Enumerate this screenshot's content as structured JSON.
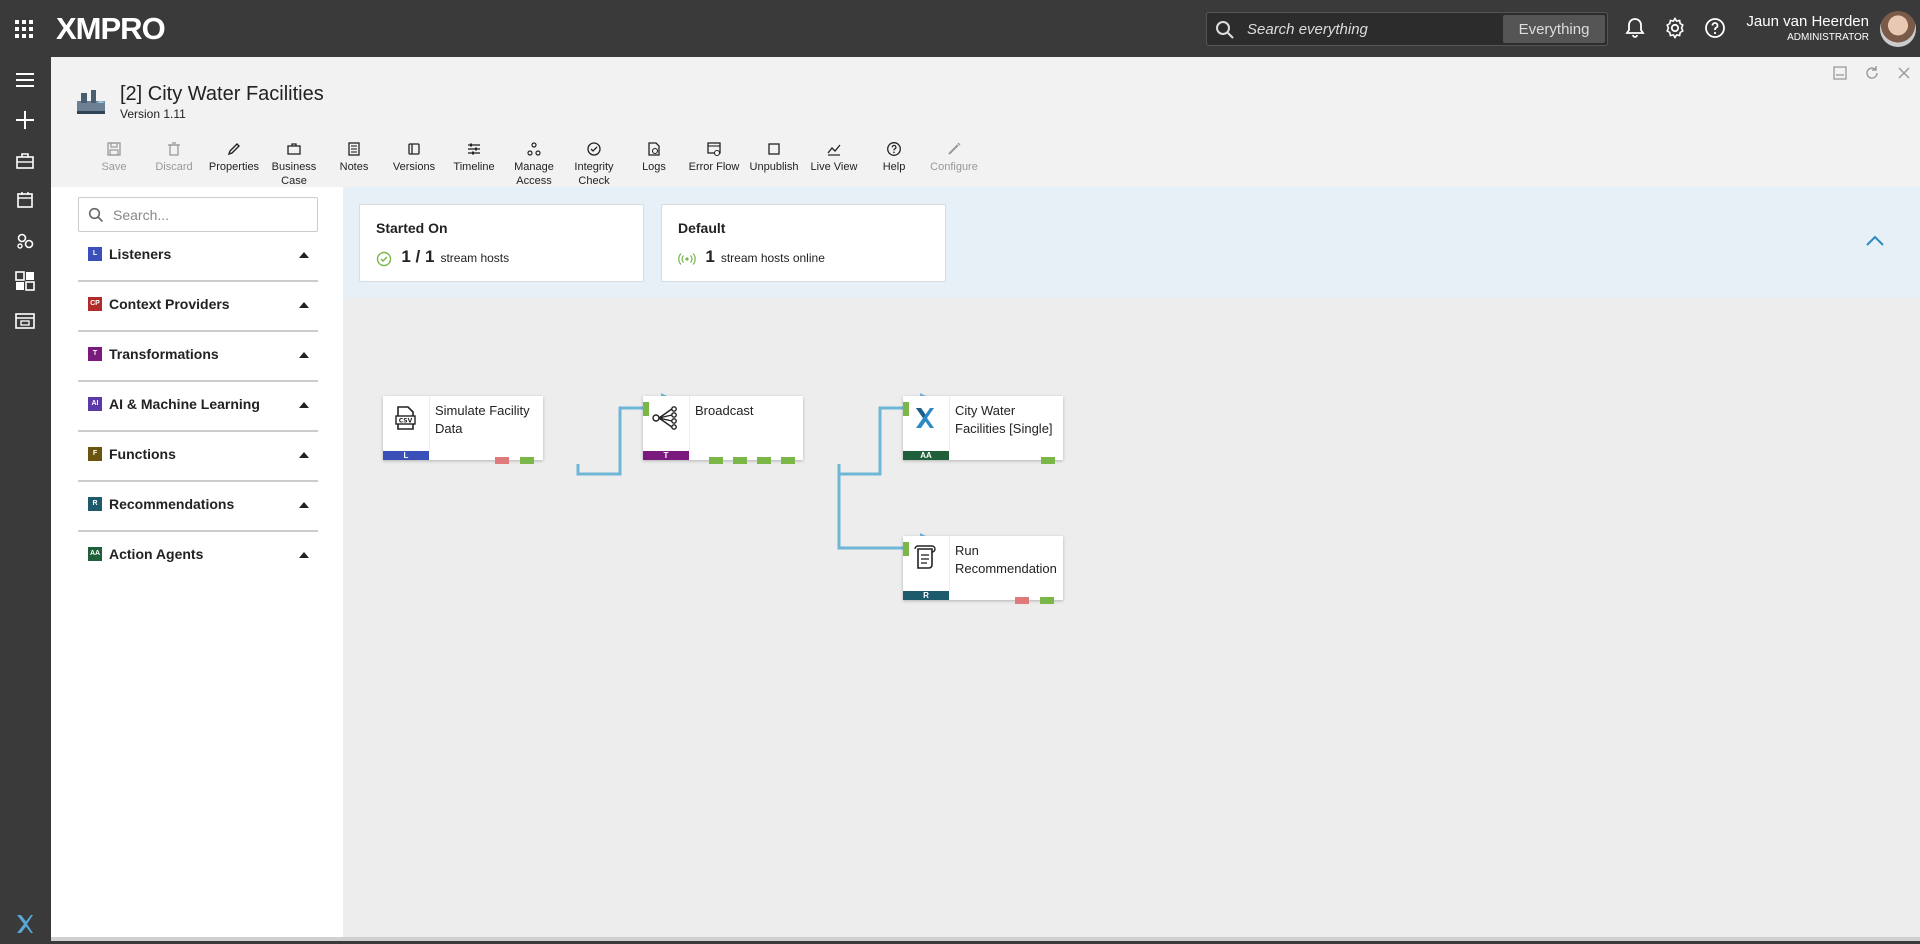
{
  "topbar": {
    "logo": "XMPRO",
    "search_placeholder": "Search everything",
    "search_scope": "Everything",
    "user_name": "Jaun van Heerden",
    "user_role": "ADMINISTRATOR"
  },
  "datastream": {
    "title": "[2] City Water Facilities",
    "version": "Version 1.11"
  },
  "toolbar": {
    "save": "Save",
    "discard": "Discard",
    "properties": "Properties",
    "business_case_1": "Business",
    "business_case_2": "Case",
    "notes": "Notes",
    "versions": "Versions",
    "timeline": "Timeline",
    "manage_access_1": "Manage",
    "manage_access_2": "Access",
    "integrity_check_1": "Integrity",
    "integrity_check_2": "Check",
    "logs": "Logs",
    "error_flow": "Error Flow",
    "unpublish": "Unpublish",
    "live_view": "Live View",
    "help": "Help",
    "configure": "Configure"
  },
  "sidebar": {
    "search_placeholder": "Search...",
    "categories": [
      {
        "badge": "L",
        "label": "Listeners",
        "color": "#3a4fb8"
      },
      {
        "badge": "CP",
        "label": "Context Providers",
        "color": "#b22b2b"
      },
      {
        "badge": "T",
        "label": "Transformations",
        "color": "#7b1a7e"
      },
      {
        "badge": "AI",
        "label": "AI & Machine Learning",
        "color": "#5b3aa8"
      },
      {
        "badge": "F",
        "label": "Functions",
        "color": "#6b5410"
      },
      {
        "badge": "R",
        "label": "Recommendations",
        "color": "#1d5a6b"
      },
      {
        "badge": "AA",
        "label": "Action Agents",
        "color": "#1f5f3a"
      }
    ]
  },
  "status": {
    "started_title": "Started On",
    "started_count": "1 / 1",
    "started_text": "stream hosts",
    "default_title": "Default",
    "default_count": "1",
    "default_text": "stream hosts online"
  },
  "nodes": {
    "simulate_1": "Simulate Facility",
    "simulate_2": "Data",
    "simulate_cat": "L",
    "broadcast": "Broadcast",
    "broadcast_cat": "T",
    "city_1": "City Water",
    "city_2": "Facilities [Single]",
    "city_cat": "AA",
    "run_1": "Run",
    "run_2": "Recommendation",
    "run_cat": "R"
  },
  "colors": {
    "port_ok": "#7ab648",
    "port_err": "#e07a7a",
    "wire": "#6fb6d6"
  }
}
